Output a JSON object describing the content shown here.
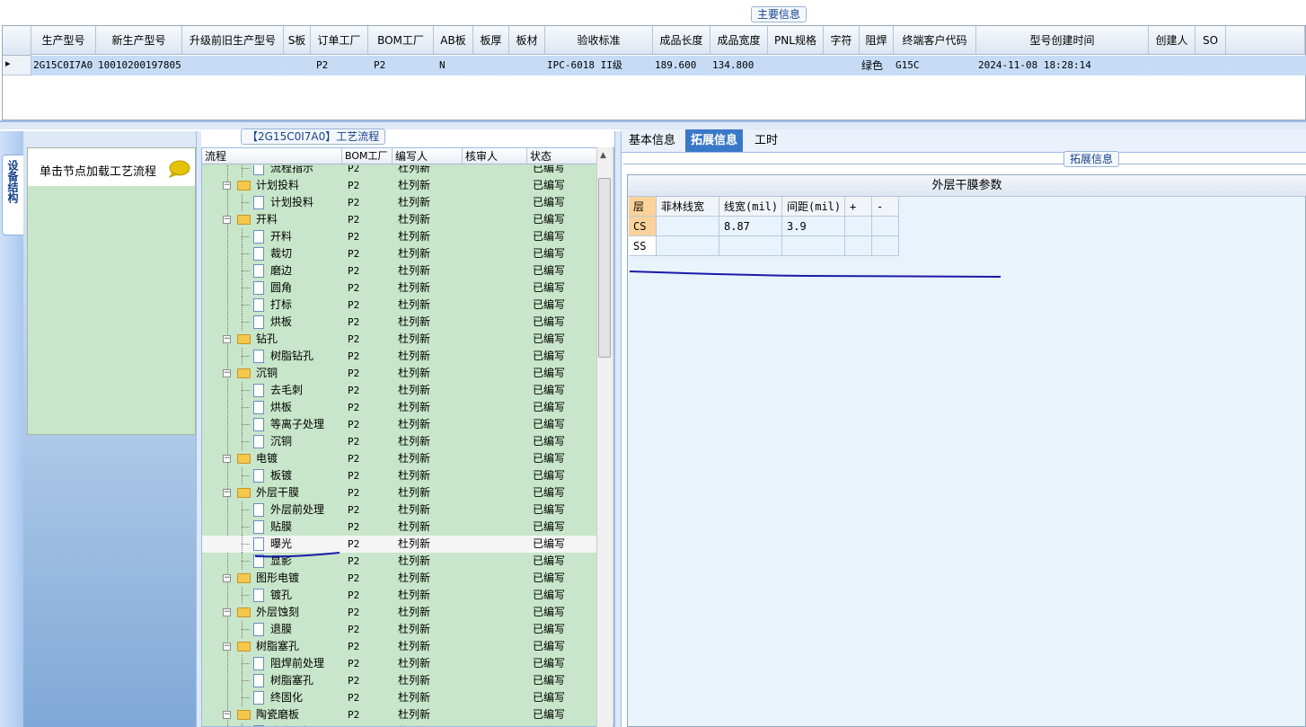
{
  "main_info": {
    "legend": "主要信息",
    "columns": [
      "生产型号",
      "新生产型号",
      "升级前旧生产型号",
      "S板",
      "订单工厂",
      "BOM工厂",
      "AB板",
      "板厚",
      "板材",
      "验收标准",
      "成品长度",
      "成品宽度",
      "PNL规格",
      "字符",
      "阻焊",
      "终端客户代码",
      "型号创建时间",
      "创建人",
      "SO"
    ],
    "row": {
      "indicator": "▸",
      "生产型号": "2G15C0I7A0",
      "新生产型号": "10010200197805",
      "升级前旧生产型号": "",
      "S板": "",
      "订单工厂": "P2",
      "BOM工厂": "P2",
      "AB板": "N",
      "板厚": "",
      "板材": "",
      "验收标准": "IPC-6018 II级",
      "成品长度": "189.600",
      "成品宽度": "134.800",
      "PNL规格": "",
      "字符": "",
      "阻焊": "绿色",
      "终端客户代码": "G15C",
      "型号创建时间": "2024-11-08 18:28:14",
      "创建人": "",
      "SO": ""
    }
  },
  "sidebar": {
    "tab_label": "设备结构"
  },
  "left_panel": {
    "hint": "单击节点加载工艺流程",
    "bubble_icon": "speech-bubble-icon"
  },
  "process": {
    "legend": "【2G15C0I7A0】工艺流程",
    "columns": [
      "流程",
      "BOM工厂",
      "编写人",
      "核审人",
      "状态"
    ],
    "rows": [
      {
        "name": "流程指示",
        "level": 2,
        "bom": "P2",
        "author": "杜列新",
        "reviewer": "",
        "status": "已编写",
        "partial": true
      },
      {
        "name": "计划投料",
        "level": 1,
        "bom": "P2",
        "author": "杜列新",
        "reviewer": "",
        "status": "已编写"
      },
      {
        "name": "计划投料",
        "level": 2,
        "bom": "P2",
        "author": "杜列新",
        "reviewer": "",
        "status": "已编写"
      },
      {
        "name": "开料",
        "level": 1,
        "bom": "P2",
        "author": "杜列新",
        "reviewer": "",
        "status": "已编写"
      },
      {
        "name": "开料",
        "level": 2,
        "bom": "P2",
        "author": "杜列新",
        "reviewer": "",
        "status": "已编写"
      },
      {
        "name": "裁切",
        "level": 2,
        "bom": "P2",
        "author": "杜列新",
        "reviewer": "",
        "status": "已编写"
      },
      {
        "name": "磨边",
        "level": 2,
        "bom": "P2",
        "author": "杜列新",
        "reviewer": "",
        "status": "已编写"
      },
      {
        "name": "圆角",
        "level": 2,
        "bom": "P2",
        "author": "杜列新",
        "reviewer": "",
        "status": "已编写"
      },
      {
        "name": "打标",
        "level": 2,
        "bom": "P2",
        "author": "杜列新",
        "reviewer": "",
        "status": "已编写"
      },
      {
        "name": "烘板",
        "level": 2,
        "bom": "P2",
        "author": "杜列新",
        "reviewer": "",
        "status": "已编写"
      },
      {
        "name": "钻孔",
        "level": 1,
        "bom": "P2",
        "author": "杜列新",
        "reviewer": "",
        "status": "已编写"
      },
      {
        "name": "树脂钻孔",
        "level": 2,
        "bom": "P2",
        "author": "杜列新",
        "reviewer": "",
        "status": "已编写"
      },
      {
        "name": "沉铜",
        "level": 1,
        "bom": "P2",
        "author": "杜列新",
        "reviewer": "",
        "status": "已编写"
      },
      {
        "name": "去毛刺",
        "level": 2,
        "bom": "P2",
        "author": "杜列新",
        "reviewer": "",
        "status": "已编写"
      },
      {
        "name": "烘板",
        "level": 2,
        "bom": "P2",
        "author": "杜列新",
        "reviewer": "",
        "status": "已编写"
      },
      {
        "name": "等离子处理",
        "level": 2,
        "bom": "P2",
        "author": "杜列新",
        "reviewer": "",
        "status": "已编写"
      },
      {
        "name": "沉铜",
        "level": 2,
        "bom": "P2",
        "author": "杜列新",
        "reviewer": "",
        "status": "已编写"
      },
      {
        "name": "电镀",
        "level": 1,
        "bom": "P2",
        "author": "杜列新",
        "reviewer": "",
        "status": "已编写"
      },
      {
        "name": "板镀",
        "level": 2,
        "bom": "P2",
        "author": "杜列新",
        "reviewer": "",
        "status": "已编写"
      },
      {
        "name": "外层干膜",
        "level": 1,
        "bom": "P2",
        "author": "杜列新",
        "reviewer": "",
        "status": "已编写"
      },
      {
        "name": "外层前处理",
        "level": 2,
        "bom": "P2",
        "author": "杜列新",
        "reviewer": "",
        "status": "已编写"
      },
      {
        "name": "贴膜",
        "level": 2,
        "bom": "P2",
        "author": "杜列新",
        "reviewer": "",
        "status": "已编写"
      },
      {
        "name": "曝光",
        "level": 2,
        "bom": "P2",
        "author": "杜列新",
        "reviewer": "",
        "status": "已编写",
        "selected": true
      },
      {
        "name": "显影",
        "level": 2,
        "bom": "P2",
        "author": "杜列新",
        "reviewer": "",
        "status": "已编写"
      },
      {
        "name": "图形电镀",
        "level": 1,
        "bom": "P2",
        "author": "杜列新",
        "reviewer": "",
        "status": "已编写"
      },
      {
        "name": "镀孔",
        "level": 2,
        "bom": "P2",
        "author": "杜列新",
        "reviewer": "",
        "status": "已编写"
      },
      {
        "name": "外层蚀刻",
        "level": 1,
        "bom": "P2",
        "author": "杜列新",
        "reviewer": "",
        "status": "已编写"
      },
      {
        "name": "退膜",
        "level": 2,
        "bom": "P2",
        "author": "杜列新",
        "reviewer": "",
        "status": "已编写"
      },
      {
        "name": "树脂塞孔",
        "level": 1,
        "bom": "P2",
        "author": "杜列新",
        "reviewer": "",
        "status": "已编写"
      },
      {
        "name": "阻焊前处理",
        "level": 2,
        "bom": "P2",
        "author": "杜列新",
        "reviewer": "",
        "status": "已编写"
      },
      {
        "name": "树脂塞孔",
        "level": 2,
        "bom": "P2",
        "author": "杜列新",
        "reviewer": "",
        "status": "已编写"
      },
      {
        "name": "终固化",
        "level": 2,
        "bom": "P2",
        "author": "杜列新",
        "reviewer": "",
        "status": "已编写"
      },
      {
        "name": "陶瓷磨板",
        "level": 1,
        "bom": "P2",
        "author": "杜列新",
        "reviewer": "",
        "status": "已编写"
      },
      {
        "name": "陶瓷磨板",
        "level": 2,
        "bom": "P2",
        "author": "杜列新",
        "reviewer": "",
        "status": "已编写",
        "partial": true
      }
    ]
  },
  "right_tabs": {
    "tabs": [
      "基本信息",
      "拓展信息",
      "工时"
    ],
    "active": 1
  },
  "extended": {
    "legend": "拓展信息",
    "title": "外层干膜参数",
    "columns": [
      "层",
      "菲林线宽",
      "线宽(mil)",
      "间距(mil)",
      "+",
      "-"
    ],
    "rows": [
      {
        "layer": "CS",
        "film_width": "",
        "line_width": "8.87",
        "spacing": "3.9",
        "plus": "",
        "minus": ""
      },
      {
        "layer": "SS",
        "film_width": "",
        "line_width": "",
        "spacing": "",
        "plus": "",
        "minus": ""
      }
    ]
  },
  "colors": {
    "accent": "#3a78c8",
    "tree_bg": "#c8e6c9",
    "selected_row": "#c6dcf6",
    "annotation": "#1a1aa8"
  }
}
